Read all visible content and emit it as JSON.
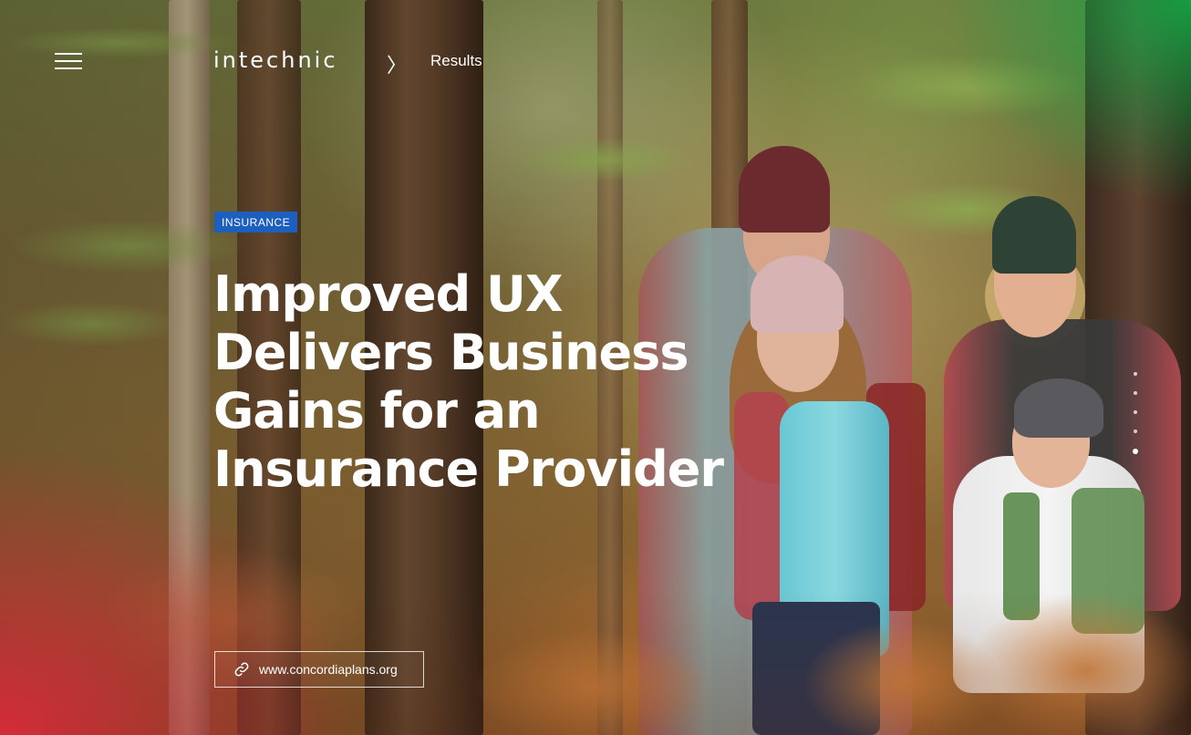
{
  "header": {
    "menu_icon": "hamburger-menu-icon",
    "logo_text": "intechnic",
    "breadcrumb_separator": "〉",
    "breadcrumb_link": "Results"
  },
  "hero": {
    "category_badge": "INSURANCE",
    "headline": "Improved UX Delivers Business Gains for an Insurance Provider",
    "site_link": {
      "icon": "link-icon",
      "label": "www.concordiaplans.org"
    }
  },
  "colors": {
    "badge_background": "#1d5fbf",
    "text": "#ffffff",
    "overlay_bottom_left": "#e6283c",
    "overlay_top_right": "#14aa46"
  },
  "slide_nav": {
    "total_dots": 5,
    "active_index": 4
  }
}
